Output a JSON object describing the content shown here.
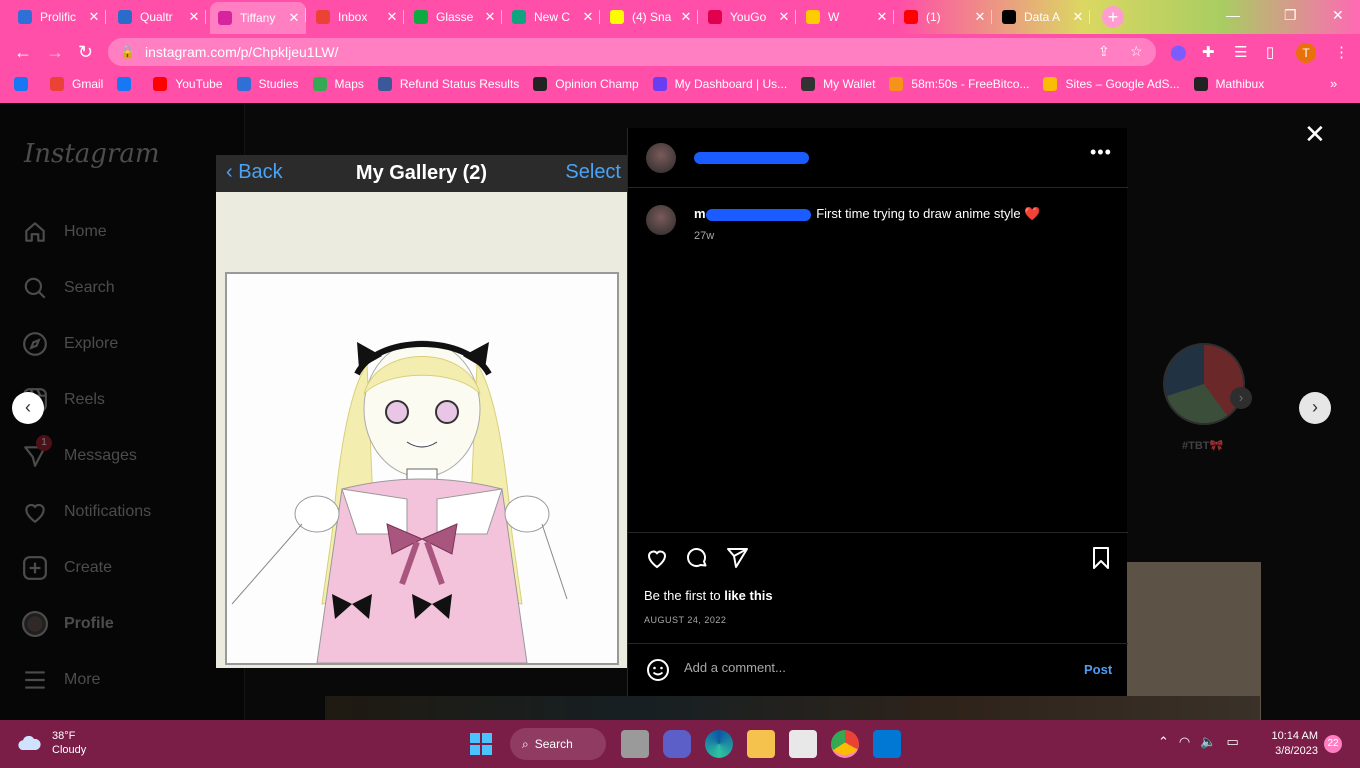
{
  "browser": {
    "tabs": [
      {
        "title": "Prolific",
        "color": "#2f6fd6"
      },
      {
        "title": "Qualtr",
        "color": "#2a6cc9"
      },
      {
        "title": "Tiffany",
        "color": "#d6249f"
      },
      {
        "title": "Inbox",
        "color": "#ea4335"
      },
      {
        "title": "Glasse",
        "color": "#0caa41"
      },
      {
        "title": "New C",
        "color": "#10a37f"
      },
      {
        "title": "(4) Sna",
        "color": "#fffc00"
      },
      {
        "title": "YouGo",
        "color": "#e0004d"
      },
      {
        "title": "W",
        "color": "#ffcc00"
      },
      {
        "title": "(1)",
        "color": "#ff0000"
      },
      {
        "title": "Data A",
        "color": "#000000"
      }
    ],
    "url": "instagram.com/p/Chpkljeu1LW/",
    "avatar_letter": "T",
    "bookmarks": [
      {
        "label": "",
        "color": "#1877f2"
      },
      {
        "label": "Gmail",
        "color": "#ea4335"
      },
      {
        "label": "",
        "color": "#1877f2"
      },
      {
        "label": "YouTube",
        "color": "#ff0000"
      },
      {
        "label": "Studies",
        "color": "#2f6fd6"
      },
      {
        "label": "Maps",
        "color": "#34a853"
      },
      {
        "label": "Refund Status Results",
        "color": "#3b5998"
      },
      {
        "label": "Opinion Champ",
        "color": "#222222"
      },
      {
        "label": "My Dashboard | Us...",
        "color": "#6a3df0"
      },
      {
        "label": "My Wallet",
        "color": "#333333"
      },
      {
        "label": "58m:50s - FreeBitco...",
        "color": "#f7931a"
      },
      {
        "label": "Sites – Google AdS...",
        "color": "#fbbc04"
      },
      {
        "label": "Mathibux",
        "color": "#222222"
      }
    ],
    "more_bookmarks": "»"
  },
  "sidebar": {
    "logo": "Instagram",
    "items": [
      {
        "label": "Home",
        "icon": "home-icon"
      },
      {
        "label": "Search",
        "icon": "search-icon"
      },
      {
        "label": "Explore",
        "icon": "compass-icon"
      },
      {
        "label": "Reels",
        "icon": "reels-icon"
      },
      {
        "label": "Messages",
        "icon": "messenger-icon",
        "badge": "1"
      },
      {
        "label": "Notifications",
        "icon": "heart-icon"
      },
      {
        "label": "Create",
        "icon": "plus-square-icon"
      },
      {
        "label": "Profile",
        "icon": "profile-avatar"
      },
      {
        "label": "More",
        "icon": "hamburger-icon"
      }
    ]
  },
  "background": {
    "story_label": "#TBT🎀"
  },
  "post": {
    "image": {
      "back": "Back",
      "title": "My Gallery (2)",
      "select": "Select"
    },
    "username_visible": "m",
    "caption": "First time trying to draw anime style",
    "caption_emoji": "❤️",
    "age": "27w",
    "likes_prefix": "Be the first to ",
    "likes_bold": "like this",
    "date": "AUGUST 24, 2022",
    "comment_placeholder": "Add a comment...",
    "post_button": "Post"
  },
  "taskbar": {
    "temp": "38°F",
    "condition": "Cloudy",
    "search": "Search",
    "time": "10:14 AM",
    "date": "3/8/2023",
    "notifications": "22"
  }
}
